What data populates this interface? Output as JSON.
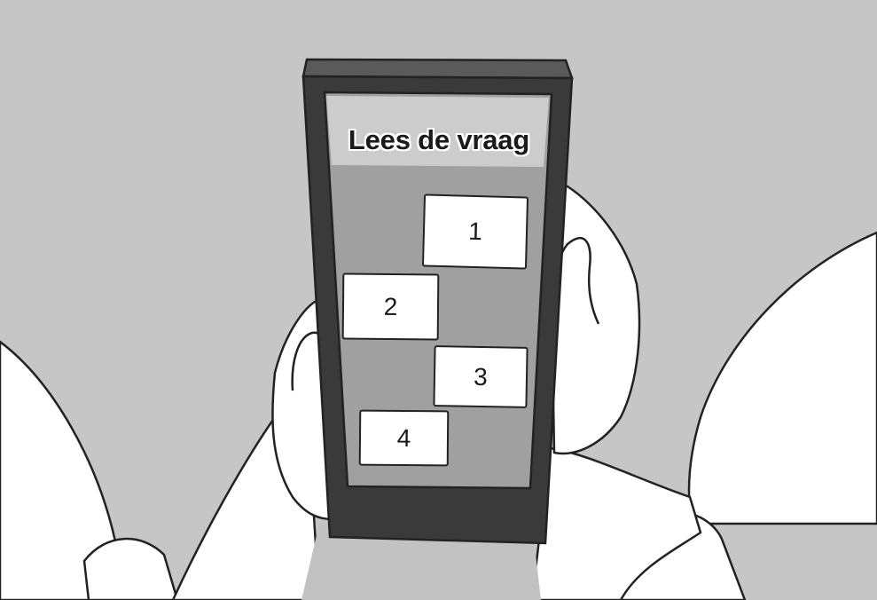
{
  "phone": {
    "screen_title": "Lees de vraag",
    "answers": [
      {
        "label": "1"
      },
      {
        "label": "2"
      },
      {
        "label": "3"
      },
      {
        "label": "4"
      }
    ]
  },
  "colors": {
    "background": "#c6c6c6",
    "phone_body": "#3a3a3a",
    "phone_top": "#555555",
    "screen_header": "#cccccc",
    "screen_body": "#a0a0a0",
    "button_fill": "#ffffff",
    "outline": "#222222"
  }
}
